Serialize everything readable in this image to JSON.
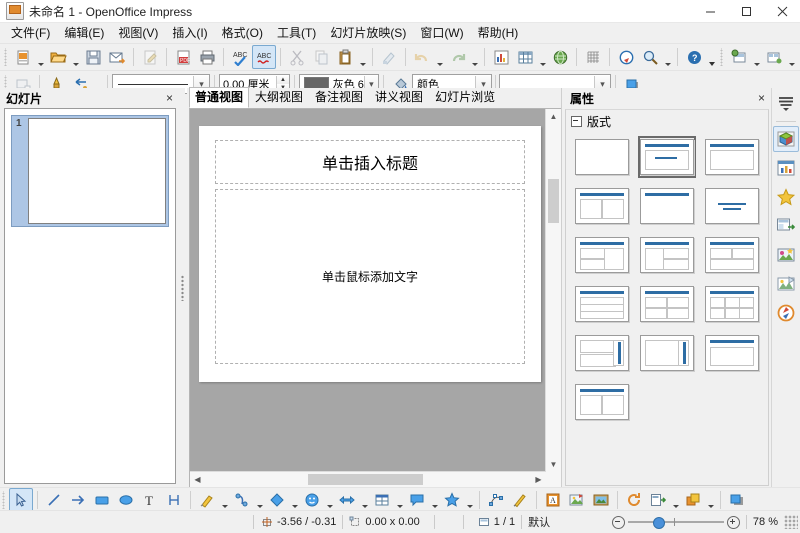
{
  "window": {
    "title": "未命名 1 - OpenOffice Impress",
    "minimize": "–",
    "maximize": "□",
    "close": "×"
  },
  "menubar": {
    "items": [
      {
        "label": "文件(F)"
      },
      {
        "label": "编辑(E)"
      },
      {
        "label": "视图(V)"
      },
      {
        "label": "插入(I)"
      },
      {
        "label": "格式(O)"
      },
      {
        "label": "工具(T)"
      },
      {
        "label": "幻灯片放映(S)"
      },
      {
        "label": "窗口(W)"
      },
      {
        "label": "帮助(H)"
      }
    ]
  },
  "standard_toolbar": {
    "items": [
      {
        "name": "new-document",
        "icon": "new-doc-icon"
      },
      {
        "name": "open",
        "icon": "open-folder-icon"
      },
      {
        "name": "save",
        "icon": "save-icon"
      },
      {
        "name": "send-email",
        "icon": "email-icon"
      },
      {
        "name": "edit-file",
        "icon": "edit-file-icon"
      },
      {
        "name": "export-pdf",
        "icon": "pdf-icon"
      },
      {
        "name": "print",
        "icon": "printer-icon"
      },
      {
        "name": "spelling",
        "icon": "spellcheck-icon"
      },
      {
        "name": "autospellcheck",
        "icon": "autospell-icon"
      },
      {
        "name": "cut",
        "icon": "scissors-icon"
      },
      {
        "name": "copy",
        "icon": "copy-icon"
      },
      {
        "name": "paste",
        "icon": "clipboard-icon"
      },
      {
        "name": "clone-formatting",
        "icon": "paintbrush-icon"
      },
      {
        "name": "undo",
        "icon": "undo-icon"
      },
      {
        "name": "redo",
        "icon": "redo-icon"
      },
      {
        "name": "insert-chart",
        "icon": "chart-icon"
      },
      {
        "name": "insert-table",
        "icon": "table-icon"
      },
      {
        "name": "insert-image",
        "icon": "image-globe-icon"
      },
      {
        "name": "display-grid",
        "icon": "grid-icon"
      },
      {
        "name": "hyperlink",
        "icon": "compass-icon"
      },
      {
        "name": "zoom",
        "icon": "magnifier-icon"
      },
      {
        "name": "help",
        "icon": "help-icon"
      }
    ]
  },
  "presentation_toolbar": {
    "items": [
      {
        "name": "new-slide",
        "icon": "new-slide-icon"
      },
      {
        "name": "slide-layout",
        "icon": "slide-layout-icon"
      },
      {
        "name": "slide-design",
        "icon": "slide-design-icon"
      },
      {
        "name": "start-slideshow",
        "icon": "slideshow-icon"
      }
    ]
  },
  "line_fill_toolbar": {
    "position_size_icon": "position-size-icon",
    "line_icon": "line-icon",
    "arrow_style_icon": "arrow-style-icon",
    "line_style": {
      "label": "",
      "name": "line-style-combo"
    },
    "line_width": {
      "value": "0.00 厘米",
      "name": "line-width-spinner"
    },
    "line_color": {
      "value": "灰色 6",
      "swatch": "#666666",
      "name": "line-color-combo"
    },
    "fill_icon": "fill-bucket-icon",
    "fill_style": {
      "value": "颜色",
      "name": "fill-style-combo"
    },
    "fill_color": {
      "value": "",
      "name": "fill-color-combo"
    },
    "shadow_icon": "shadow-icon"
  },
  "slide_panel": {
    "title": "幻灯片",
    "close": "×",
    "slides": [
      {
        "number": "1"
      }
    ]
  },
  "view_tabs": {
    "tabs": [
      {
        "label": "普通视图",
        "active": true
      },
      {
        "label": "大纲视图",
        "active": false
      },
      {
        "label": "备注视图",
        "active": false
      },
      {
        "label": "讲义视图",
        "active": false
      },
      {
        "label": "幻灯片浏览",
        "active": false
      }
    ]
  },
  "slide_canvas": {
    "title_placeholder": "单击插入标题",
    "body_placeholder": "单击鼠标添加文字"
  },
  "properties_panel": {
    "title": "属性",
    "close": "×",
    "sections": [
      {
        "title": "版式",
        "layouts": [
          {
            "name": "blank",
            "selected": false
          },
          {
            "name": "title-content",
            "selected": true
          },
          {
            "name": "title-only-content",
            "selected": false
          },
          {
            "name": "title-two-content",
            "selected": false
          },
          {
            "name": "title-blank",
            "selected": false
          },
          {
            "name": "centered-text",
            "selected": false
          },
          {
            "name": "title-content-two-right",
            "selected": false
          },
          {
            "name": "title-content-left-two-right",
            "selected": false
          },
          {
            "name": "title-two-top-one-bottom",
            "selected": false
          },
          {
            "name": "title-three-rows",
            "selected": false
          },
          {
            "name": "title-four-content",
            "selected": false
          },
          {
            "name": "title-six-content",
            "selected": false
          },
          {
            "name": "two-content-vertical-bar",
            "selected": false
          },
          {
            "name": "content-vertical-bar",
            "selected": false
          },
          {
            "name": "title-single-content",
            "selected": false
          },
          {
            "name": "title-two-columns",
            "selected": false
          }
        ]
      }
    ]
  },
  "sidebar_rail": {
    "items": [
      {
        "name": "sidebar-settings",
        "icon": "hamburger-menu-icon",
        "active": false
      },
      {
        "name": "properties",
        "icon": "properties-cube-icon",
        "active": true
      },
      {
        "name": "slide-transition",
        "icon": "transition-chart-icon",
        "active": false
      },
      {
        "name": "custom-animation",
        "icon": "star-icon",
        "active": false
      },
      {
        "name": "master-slides",
        "icon": "master-slides-icon",
        "active": false
      },
      {
        "name": "gallery",
        "icon": "gallery-icon",
        "active": false
      },
      {
        "name": "styles",
        "icon": "styles-image-icon",
        "active": false
      },
      {
        "name": "navigator",
        "icon": "navigator-compass-icon",
        "active": false
      }
    ]
  },
  "drawing_toolbar": {
    "items": [
      {
        "name": "select",
        "icon": "arrow-cursor-icon",
        "active": true
      },
      {
        "name": "line",
        "icon": "line-icon"
      },
      {
        "name": "line-ends-arrow",
        "icon": "arrow-icon"
      },
      {
        "name": "rectangle",
        "icon": "rectangle-icon"
      },
      {
        "name": "ellipse",
        "icon": "ellipse-icon"
      },
      {
        "name": "text-box",
        "icon": "text-icon"
      },
      {
        "name": "dimension-line",
        "icon": "dimension-line-icon"
      },
      {
        "name": "curve",
        "icon": "curve-pen-icon"
      },
      {
        "name": "connector",
        "icon": "connector-icon"
      },
      {
        "name": "basic-shapes",
        "icon": "diamond-shape-icon"
      },
      {
        "name": "symbol-shapes",
        "icon": "smiley-icon"
      },
      {
        "name": "block-arrows",
        "icon": "block-arrow-icon"
      },
      {
        "name": "flowchart",
        "icon": "flowchart-icon"
      },
      {
        "name": "callouts",
        "icon": "callout-icon"
      },
      {
        "name": "stars",
        "icon": "star-shape-icon"
      },
      {
        "name": "points",
        "icon": "edit-points-icon"
      },
      {
        "name": "glue-points",
        "icon": "glue-point-icon"
      },
      {
        "name": "fontwork",
        "icon": "fontwork-icon"
      },
      {
        "name": "insert-image-file",
        "icon": "insert-image-icon"
      },
      {
        "name": "insert-media",
        "icon": "media-icon"
      },
      {
        "name": "rotate",
        "icon": "rotate-icon"
      },
      {
        "name": "align",
        "icon": "align-icon"
      },
      {
        "name": "arrange",
        "icon": "arrange-icon"
      },
      {
        "name": "shadow-tool",
        "icon": "shadow-tool-icon"
      }
    ]
  },
  "statusbar": {
    "cursor_icon": "cursor-position-icon",
    "cursor_position": "-3.56 / -0.31",
    "size_icon": "object-size-icon",
    "object_size": "0.00 x 0.00",
    "slide_icon": "slide-count-icon",
    "slide_count": "1 / 1",
    "master_name": "默认",
    "zoom_out": "−",
    "zoom_in": "+",
    "zoom_level": "78 %"
  }
}
